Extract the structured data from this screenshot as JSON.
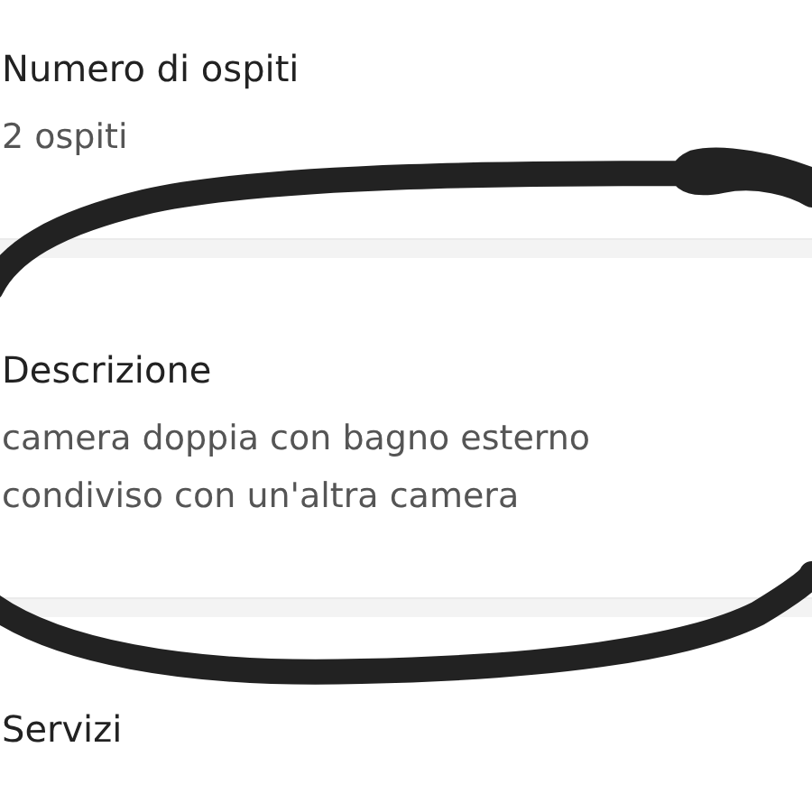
{
  "sections": [
    {
      "title": "Numero di ospiti",
      "lines": [
        "2 ospiti"
      ]
    },
    {
      "title": "Descrizione",
      "lines": [
        "camera doppia con bagno esterno",
        "condiviso con un'altra camera"
      ]
    },
    {
      "title": "Servizi"
    }
  ]
}
